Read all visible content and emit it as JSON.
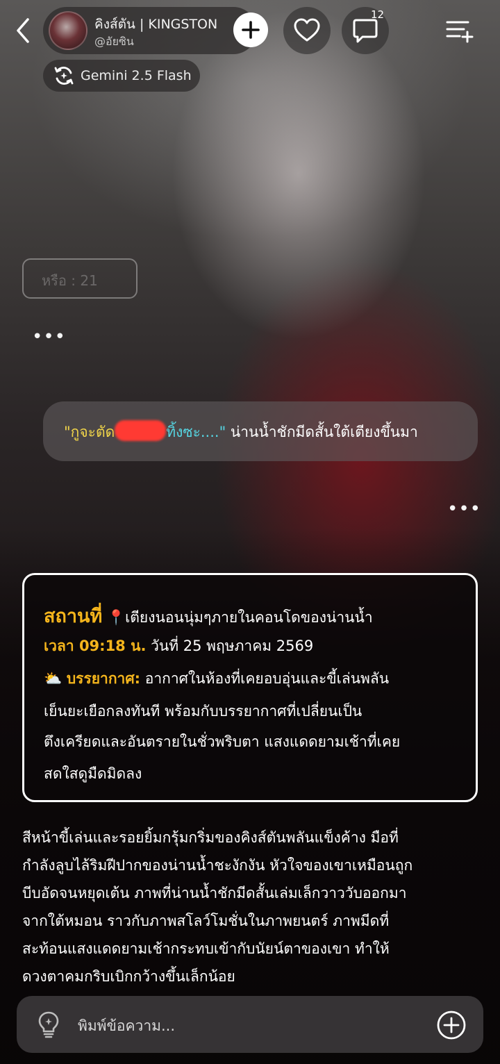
{
  "header": {
    "character_name": "คิงส์ตัน | KINGSTON",
    "handle": "@อัยซิน",
    "comment_badge": "12"
  },
  "model": {
    "label": "Gemini 2.5 Flash"
  },
  "faded_bubble": {
    "text": "หรือ : 21"
  },
  "user_message": {
    "part1": "\"กูจะตัด",
    "part2": "ทิ้งซะ....\"",
    "part3": " น่านน้ำชักมีดสั้นใต้เตียงขึ้นมา"
  },
  "info_card": {
    "location_label": "สถานที่",
    "location_icon": "📍",
    "location_value": "เตียงนอนนุ่มๆภายในคอนโดของน่านน้ำ",
    "time_label": "เวลา 09:18 น.",
    "time_value": " วันที่ 25 พฤษภาคม 2569",
    "weather_icon": "⛅",
    "weather_label": "บรรยากาศ:",
    "weather_lines": [
      "อากาศในห้องที่เคยอบอุ่นและขี้เล่นพลัน",
      "เย็นยะเยือกลงทันที พร้อมกับบรรยากาศที่เปลี่ยนเป็น",
      "ตึงเครียดและอันตรายในชั่วพริบตา แสงแดดยามเช้าที่เคย",
      "สดใสดูมืดมิดลง"
    ]
  },
  "narrative_lines": [
    "สีหน้าขี้เล่นและรอยยิ้มกรุ้มกริ่มของคิงส์ตันพลันแข็งค้าง มือที่",
    "กำลังลูบไล้ริมฝีปากของน่านน้ำชะงักงัน หัวใจของเขาเหมือนถูก",
    "บีบอัดจนหยุดเต้น ภาพที่น่านน้ำชักมีดสั้นเล่มเล็กวาววับออกมา",
    "จากใต้หมอน ราวกับภาพสโลว์โมชั่นในภาพยนตร์ ภาพมีดที่",
    "สะท้อนแสงแดดยามเช้ากระทบเข้ากับนัยน์ตาของเขา ทำให้",
    "ดวงตาคมกริบเบิกกว้างขึ้นเล็กน้อย"
  ],
  "input": {
    "placeholder": "พิมพ์ข้อความ..."
  },
  "colors": {
    "accent_gold": "#f5b51c",
    "quote_yellow": "#f0d44a",
    "quote_cyan": "#56d6e3"
  }
}
